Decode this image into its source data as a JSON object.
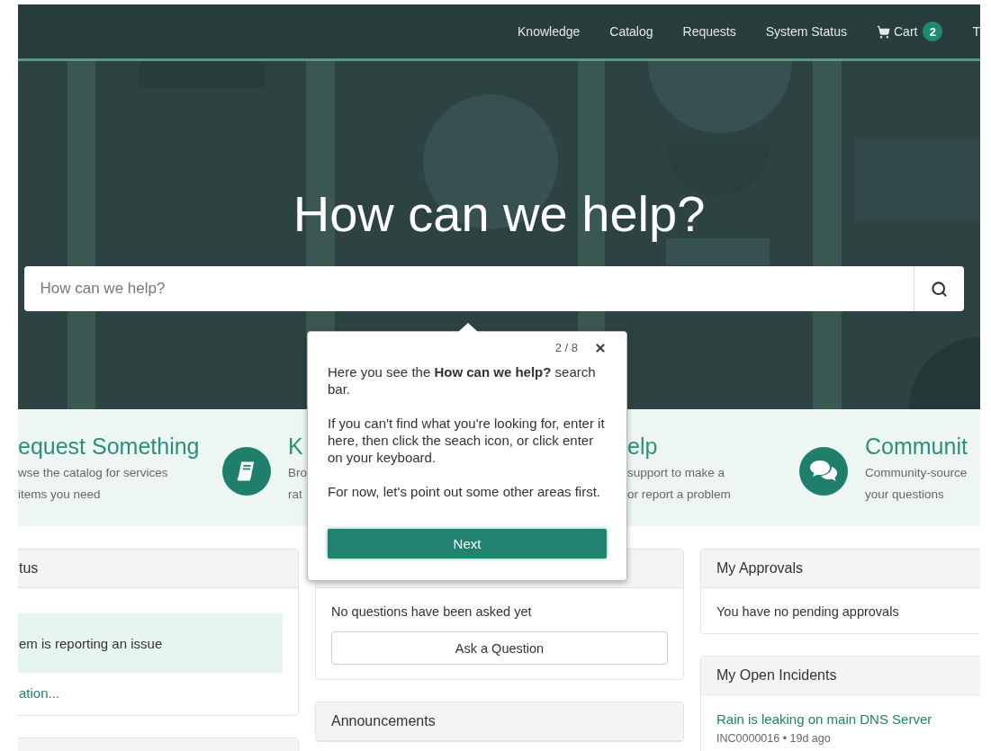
{
  "nav": {
    "links": [
      "Knowledge",
      "Catalog",
      "Requests",
      "System Status"
    ],
    "cart": {
      "label": "Cart",
      "count": "2"
    },
    "cut_link": "T"
  },
  "hero": {
    "title": "How can we help?",
    "search": {
      "placeholder": "How can we help?"
    }
  },
  "features": [
    {
      "title": "equest Something",
      "lines": [
        "wse the catalog for services",
        "items you need"
      ],
      "kind": "text"
    },
    {
      "title": "K",
      "lines": [
        "Bro",
        "rat"
      ],
      "kind": "book"
    },
    {
      "title": "elp",
      "lines": [
        "support to make a",
        "or report a problem"
      ],
      "kind": "text"
    },
    {
      "title": "Communit",
      "lines": [
        "Community-source",
        "your questions"
      ],
      "kind": "chat"
    }
  ],
  "columns": [
    [
      {
        "title": "tus",
        "blocks": [
          {
            "kind": "alert",
            "text": "em is reporting an issue"
          },
          {
            "kind": "link",
            "text": "ation..."
          }
        ]
      },
      {}
    ],
    [
      {
        "blocks": [
          {
            "kind": "text",
            "text": "No questions have been asked yet"
          },
          {
            "kind": "button",
            "text": "Ask a Question"
          }
        ]
      },
      {
        "title": "Announcements"
      }
    ],
    [
      {
        "title": "My Approvals",
        "blocks": [
          {
            "kind": "text",
            "text": "You have no pending approvals"
          }
        ]
      },
      {
        "title": "My Open Incidents",
        "blocks": [
          {
            "kind": "link",
            "text": "Rain is leaking on main DNS Server"
          },
          {
            "kind": "meta",
            "text": "INC0000016 • 19d ago"
          }
        ]
      }
    ]
  ],
  "tour": {
    "step": "2 / 8",
    "paragraphs": [
      "Here you see the **How can we help?** search bar.",
      "If you can't find what you're looking for, enter it here, then click the seach icon, or click enter on your keyboard.",
      "For now, let's point out some other areas first."
    ],
    "button": "Next"
  }
}
